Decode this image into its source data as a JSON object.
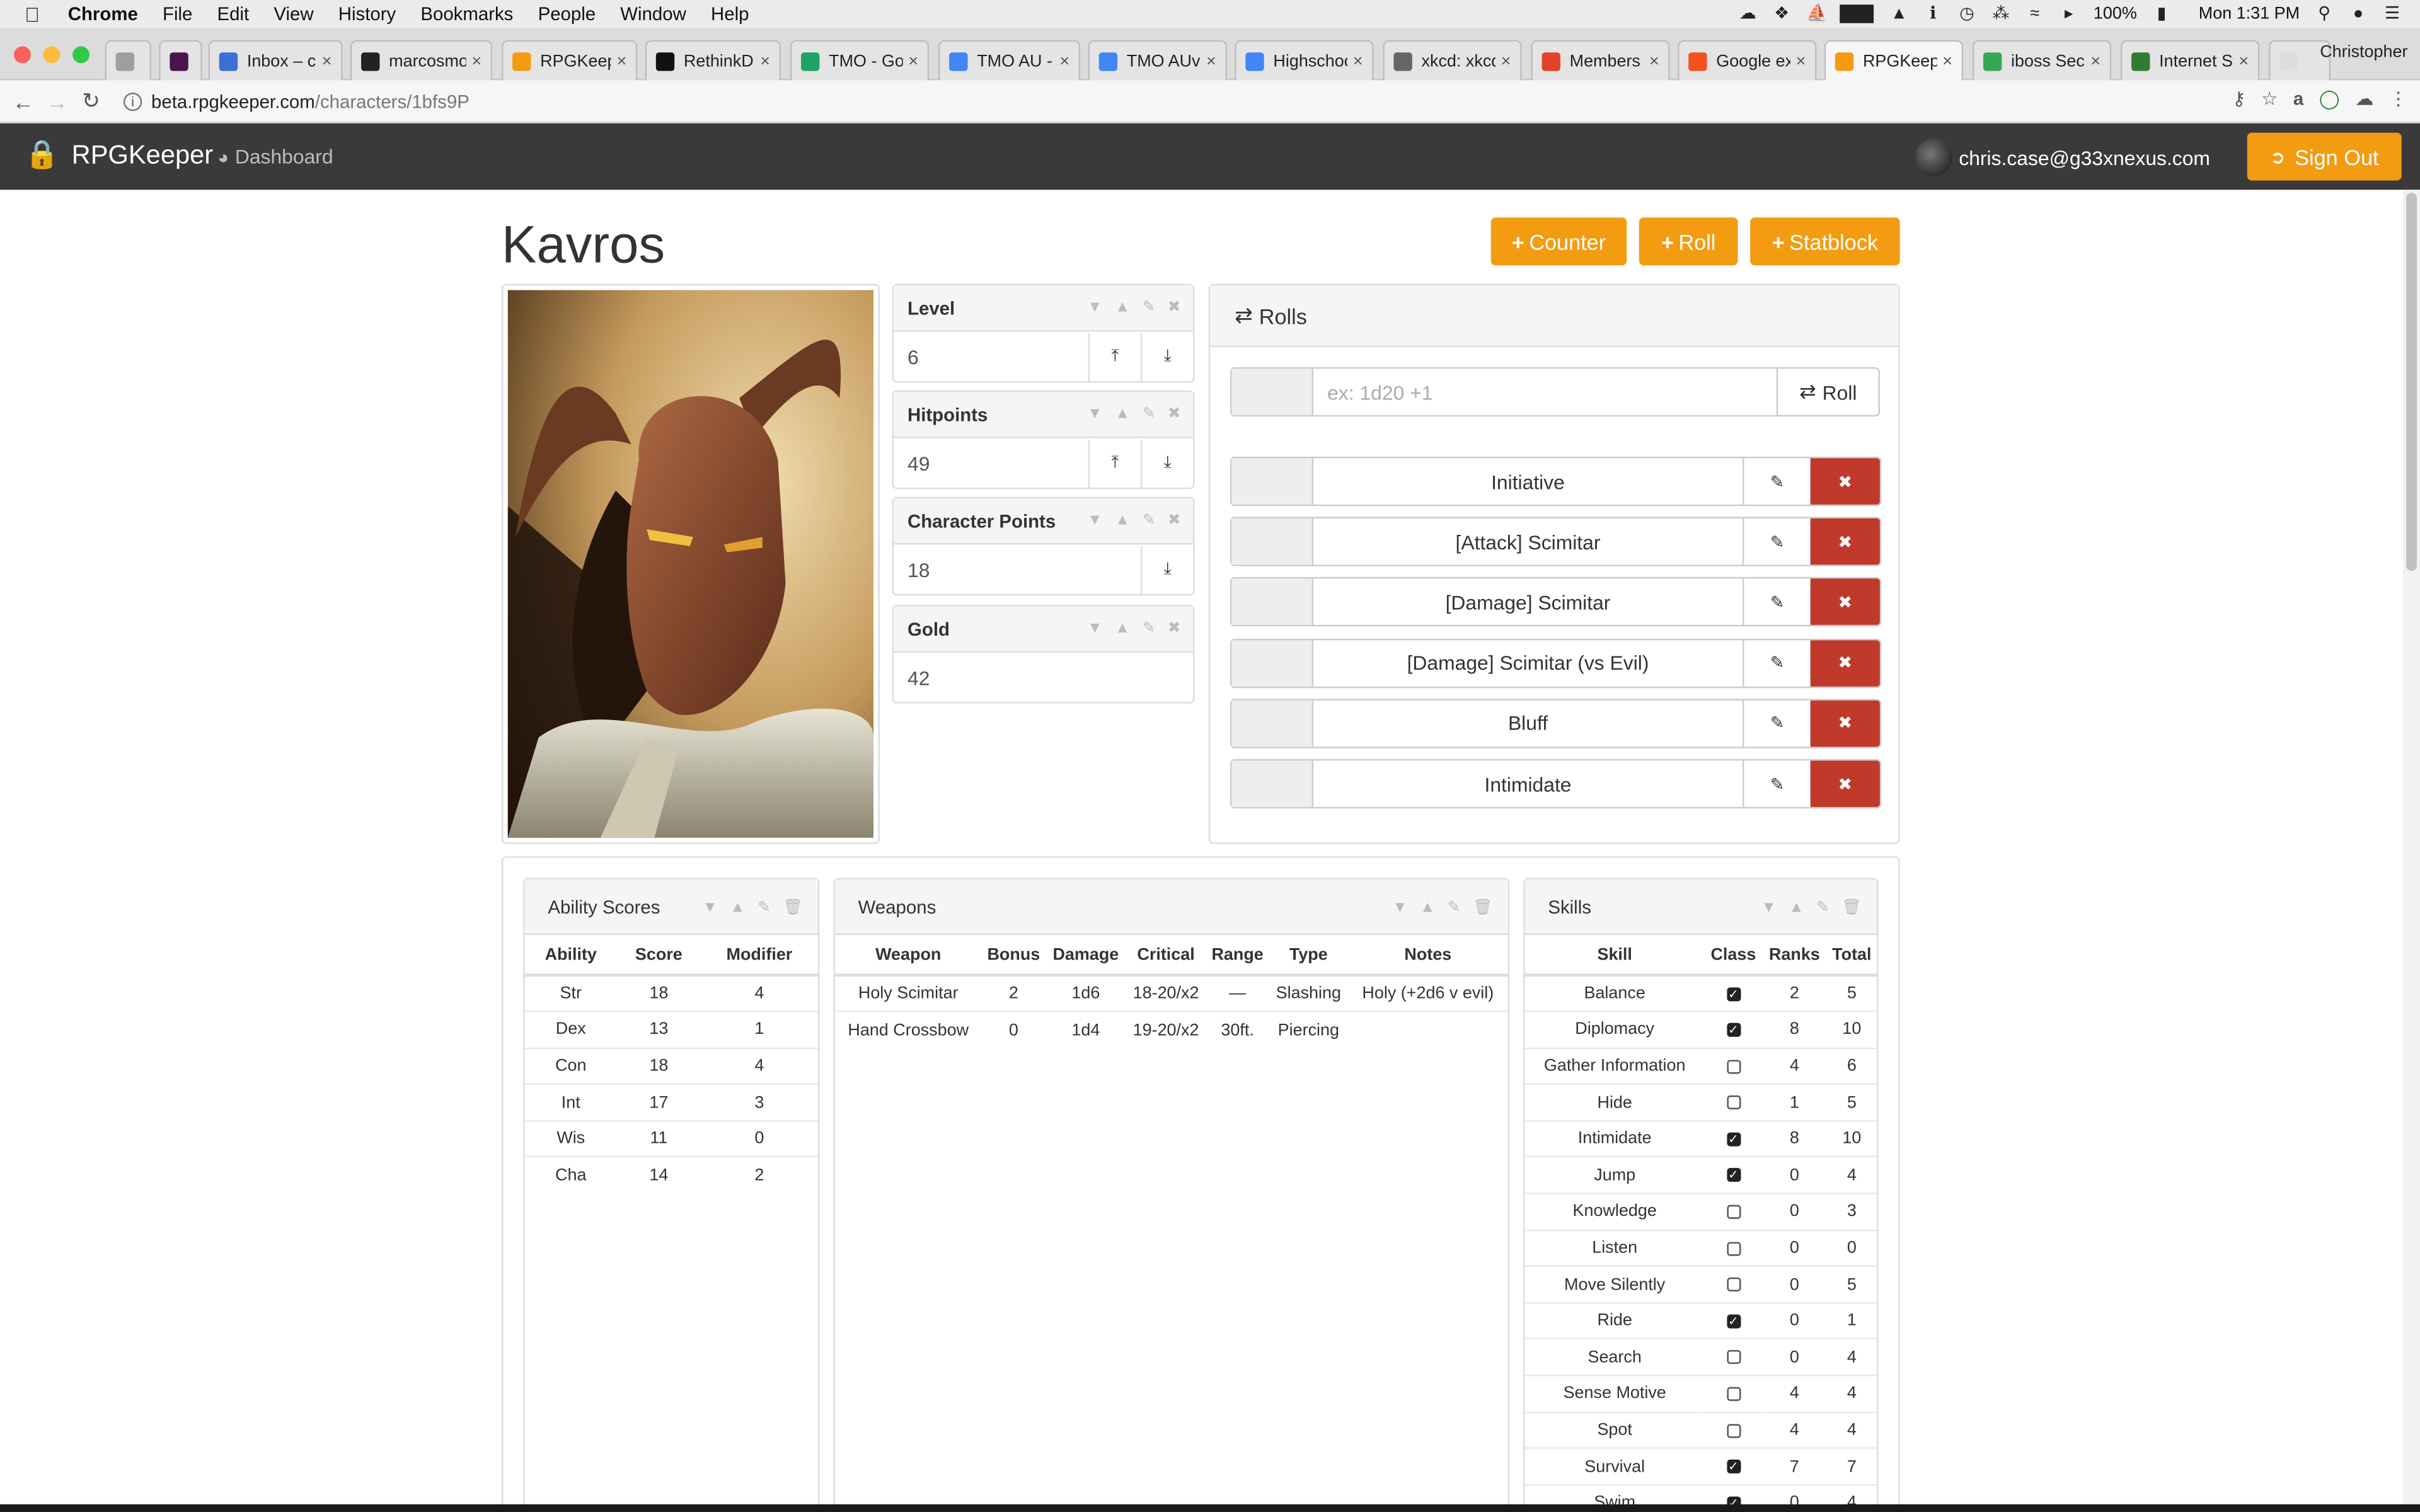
{
  "menubar": {
    "app": "Chrome",
    "items": [
      "File",
      "Edit",
      "View",
      "History",
      "Bookmarks",
      "People",
      "Window",
      "Help"
    ],
    "battery": "100%",
    "clock": "Mon 1:31 PM"
  },
  "tabs": [
    {
      "label": "",
      "color": "#9e9e9e"
    },
    {
      "label": "",
      "color": "#4a154b"
    },
    {
      "label": "Inbox – chr",
      "color": "#3b6fd4"
    },
    {
      "label": "marcosmo",
      "color": "#222222"
    },
    {
      "label": "RPGKeeper",
      "color": "#f39c12"
    },
    {
      "label": "RethinkDB",
      "color": "#111111"
    },
    {
      "label": "TMO - Goo",
      "color": "#1fa463"
    },
    {
      "label": "TMO AU - I",
      "color": "#4285f4"
    },
    {
      "label": "TMO AUve",
      "color": "#4285f4"
    },
    {
      "label": "Highschoo",
      "color": "#4285f4"
    },
    {
      "label": "xkcd: xkcd",
      "color": "#666666"
    },
    {
      "label": "Members",
      "color": "#e24329"
    },
    {
      "label": "Google exp",
      "color": "#f4511e"
    },
    {
      "label": "RPGKeeper",
      "color": "#f39c12"
    },
    {
      "label": "iboss Secu",
      "color": "#34a853"
    },
    {
      "label": "Internet St",
      "color": "#2e7d32"
    },
    {
      "label": "",
      "color": "#dddddd"
    }
  ],
  "profile": "Christopher",
  "address": {
    "host": "beta.rpgkeeper.com",
    "path": "/characters/1bfs9P"
  },
  "app": {
    "brand": "RPGKeeper",
    "dashboard": "Dashboard",
    "user_email": "chris.case@g33xnexus.com",
    "signout": "Sign Out"
  },
  "character": {
    "name": "Kavros"
  },
  "actions": {
    "counter": "Counter",
    "roll": "Roll",
    "statblock": "Statblock"
  },
  "counters": [
    {
      "label": "Level",
      "value": "6",
      "buttons": 2
    },
    {
      "label": "Hitpoints",
      "value": "49",
      "buttons": 2
    },
    {
      "label": "Character Points",
      "value": "18",
      "buttons": 1
    },
    {
      "label": "Gold",
      "value": "42",
      "buttons": 0
    }
  ],
  "rolls": {
    "title": "Rolls",
    "placeholder": "ex: 1d20 +1",
    "roll_button": "Roll",
    "items": [
      "Initiative",
      "[Attack] Scimitar",
      "[Damage] Scimitar",
      "[Damage] Scimitar (vs Evil)",
      "Bluff",
      "Intimidate"
    ]
  },
  "ability_scores": {
    "title": "Ability Scores",
    "columns": [
      "Ability",
      "Score",
      "Modifier"
    ],
    "rows": [
      [
        "Str",
        "18",
        "4"
      ],
      [
        "Dex",
        "13",
        "1"
      ],
      [
        "Con",
        "18",
        "4"
      ],
      [
        "Int",
        "17",
        "3"
      ],
      [
        "Wis",
        "11",
        "0"
      ],
      [
        "Cha",
        "14",
        "2"
      ]
    ]
  },
  "weapons": {
    "title": "Weapons",
    "columns": [
      "Weapon",
      "Bonus",
      "Damage",
      "Critical",
      "Range",
      "Type",
      "Notes"
    ],
    "rows": [
      [
        "Holy Scimitar",
        "2",
        "1d6",
        "18-20/x2",
        "—",
        "Slashing",
        "Holy (+2d6 v evil)"
      ],
      [
        "Hand Crossbow",
        "0",
        "1d4",
        "19-20/x2",
        "30ft.",
        "Piercing",
        ""
      ]
    ]
  },
  "skills": {
    "title": "Skills",
    "columns": [
      "Skill",
      "Class",
      "Ranks",
      "Total"
    ],
    "rows": [
      {
        "skill": "Balance",
        "class": true,
        "ranks": "2",
        "total": "5"
      },
      {
        "skill": "Diplomacy",
        "class": true,
        "ranks": "8",
        "total": "10"
      },
      {
        "skill": "Gather Information",
        "class": false,
        "ranks": "4",
        "total": "6"
      },
      {
        "skill": "Hide",
        "class": false,
        "ranks": "1",
        "total": "5"
      },
      {
        "skill": "Intimidate",
        "class": true,
        "ranks": "8",
        "total": "10"
      },
      {
        "skill": "Jump",
        "class": true,
        "ranks": "0",
        "total": "4"
      },
      {
        "skill": "Knowledge",
        "class": false,
        "ranks": "0",
        "total": "3"
      },
      {
        "skill": "Listen",
        "class": false,
        "ranks": "0",
        "total": "0"
      },
      {
        "skill": "Move Silently",
        "class": false,
        "ranks": "0",
        "total": "5"
      },
      {
        "skill": "Ride",
        "class": true,
        "ranks": "0",
        "total": "1"
      },
      {
        "skill": "Search",
        "class": false,
        "ranks": "0",
        "total": "4"
      },
      {
        "skill": "Sense Motive",
        "class": false,
        "ranks": "4",
        "total": "4"
      },
      {
        "skill": "Spot",
        "class": false,
        "ranks": "4",
        "total": "4"
      },
      {
        "skill": "Survival",
        "class": true,
        "ranks": "7",
        "total": "7"
      },
      {
        "skill": "Swim",
        "class": true,
        "ranks": "0",
        "total": "4"
      }
    ]
  }
}
